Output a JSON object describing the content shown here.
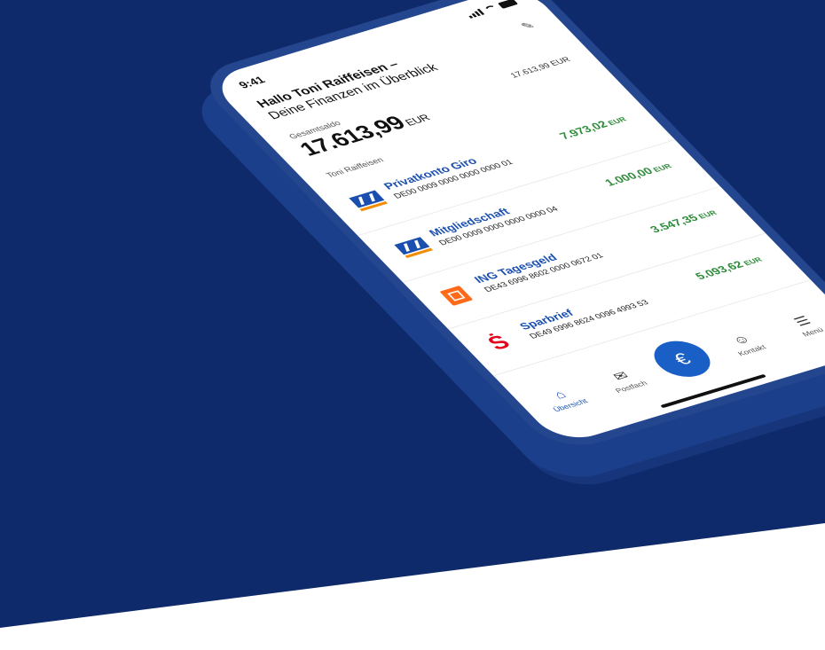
{
  "status": {
    "time": "9:41"
  },
  "greeting": {
    "line1": "Hallo Toni Raiffeisen –",
    "line2": "Deine Finanzen im Überblick"
  },
  "total": {
    "label": "Gesamtsaldo",
    "value": "17.613,99",
    "currency": "EUR"
  },
  "section": {
    "owner": "Toni Raiffeisen",
    "sum": "17.613,99 EUR"
  },
  "accounts": [
    {
      "name": "Privatkonto Giro",
      "iban": "DE00 0009 0000 0000 0000 01",
      "balance": "7.973,02",
      "currency": "EUR",
      "logo": "vr-bank-logo"
    },
    {
      "name": "Mitgliedschaft",
      "iban": "DE00 0009 0000 0000 0000 04",
      "balance": "1.000,00",
      "currency": "EUR",
      "logo": "vr-bank-logo"
    },
    {
      "name": "ING Tagesgeld",
      "iban": "DE43 6996 8602 0000 0672 01",
      "balance": "3.547,35",
      "currency": "EUR",
      "logo": "ing-logo"
    },
    {
      "name": "Sparbrief",
      "iban": "DE49 6996 8624 0096 4993 53",
      "balance": "5.093,62",
      "currency": "EUR",
      "logo": "sparkasse-logo"
    }
  ],
  "tabs": {
    "overview": "Übersicht",
    "postbox": "Postfach",
    "contact": "Kontakt",
    "menu": "Menü",
    "fab_symbol": "€"
  },
  "colors": {
    "navy": "#0f2a6b",
    "brand_blue": "#1a4fb0",
    "positive": "#2e8b3a",
    "accent_orange": "#f28c00",
    "sparkasse_red": "#e3001b"
  }
}
